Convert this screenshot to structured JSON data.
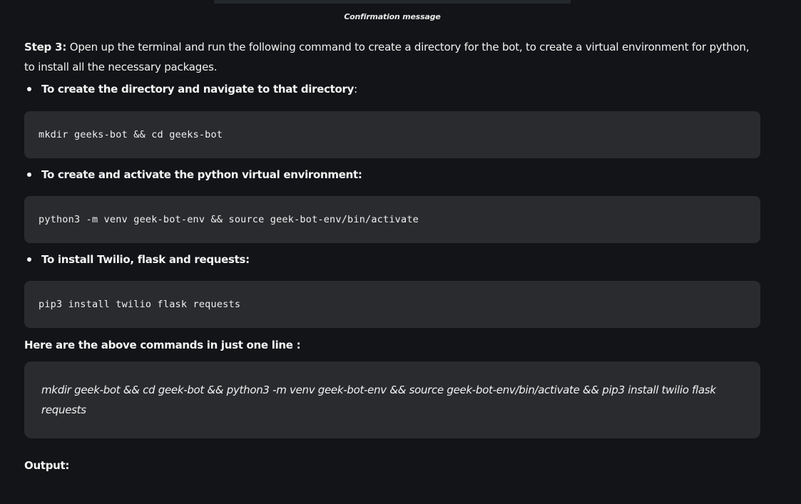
{
  "caption": "Confirmation message",
  "step": {
    "label": "Step 3:",
    "text": " Open up the terminal and run the following command to create a directory for the bot, to create a virtual environment for python, to install all the necessary packages."
  },
  "bullets": [
    {
      "label": "To create  the directory and navigate to that directory",
      "suffix": ":"
    },
    {
      "label": "To create and activate the python virtual environment:",
      "suffix": ""
    },
    {
      "label": "To install Twilio, flask and requests:",
      "suffix": ""
    }
  ],
  "code_blocks": [
    "mkdir geeks-bot && cd geeks-bot",
    "python3 -m venv geek-bot-env && source geek-bot-env/bin/activate",
    "pip3 install twilio flask requests"
  ],
  "one_line": {
    "heading": "Here are the above commands in just one line :",
    "command": "mkdir geek-bot && cd geek-bot && python3 -m venv geek-bot-env && source geek-bot-env/bin/activate && pip3 install twilio flask requests"
  },
  "output_heading": "Output:"
}
